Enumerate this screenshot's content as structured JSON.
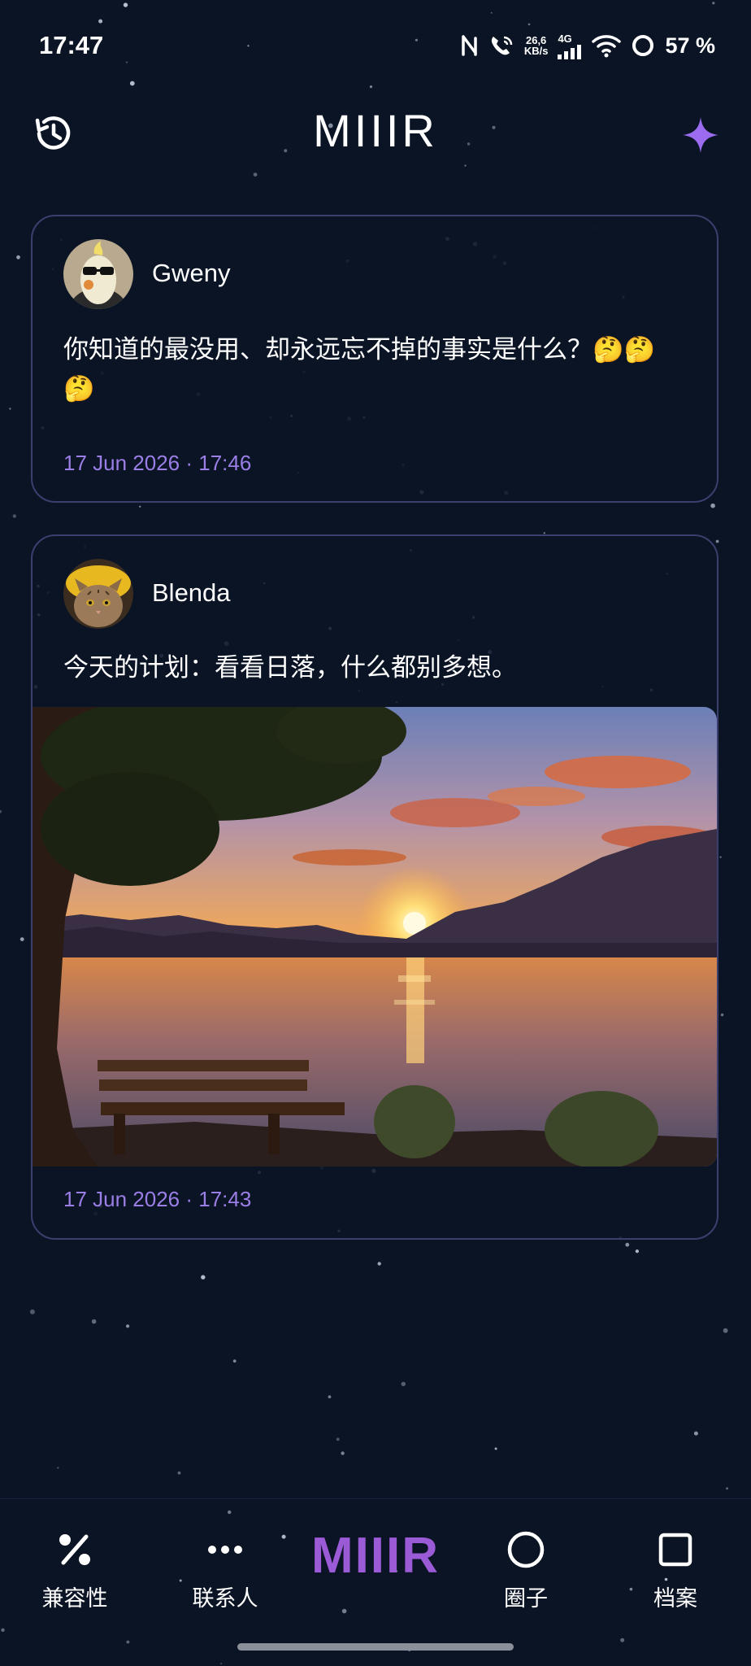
{
  "status_bar": {
    "time": "17:47",
    "net_speed_value": "26,6",
    "net_speed_unit": "KB/s",
    "network_type": "4G",
    "battery_percent": "57 %",
    "icons": [
      "nfc-icon",
      "wifi-calling-icon",
      "signal-icon",
      "wifi-icon",
      "battery-ring-icon"
    ]
  },
  "header": {
    "title": "MIIIR",
    "left_icon": "history-icon",
    "right_icon": "sparkle-icon"
  },
  "posts": [
    {
      "author": "Gweny",
      "text": "你知道的最没用、却永远忘不掉的事实是什么？🤔🤔🤔",
      "timestamp": "17 Jun 2026 · 17:46",
      "avatar": "cockatiel-with-sunglasses"
    },
    {
      "author": "Blenda",
      "text": "今天的计划：看看日落，什么都别多想。",
      "timestamp": "17 Jun 2026 · 17:43",
      "avatar": "cat-with-yellow-hat",
      "image": "sunset-over-lake-with-bench"
    }
  ],
  "bottom_nav": {
    "items": [
      {
        "label": "兼容性",
        "icon": "percent-icon"
      },
      {
        "label": "联系人",
        "icon": "more-dots-icon"
      },
      {
        "label": "圈子",
        "icon": "circle-icon"
      },
      {
        "label": "档案",
        "icon": "square-icon"
      }
    ],
    "center_logo": "MIIIR"
  },
  "colors": {
    "background": "#0b1424",
    "card_border": "#3a3f6e",
    "accent_purple": "#9b7ee6",
    "logo_purple": "#9b5bd6"
  }
}
